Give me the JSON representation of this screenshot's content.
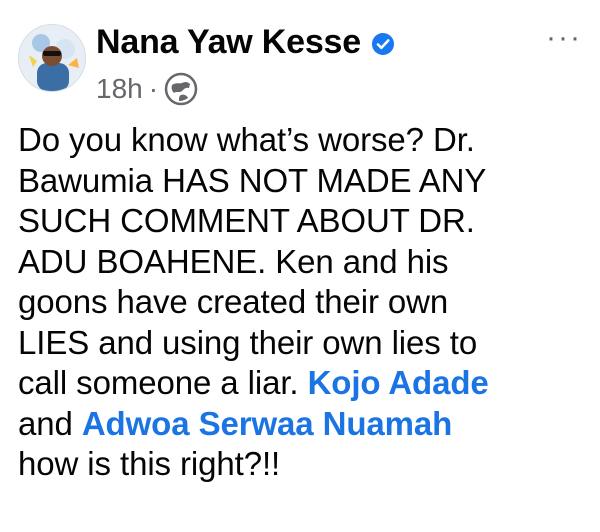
{
  "post": {
    "author": {
      "name": "Nana Yaw Kesse",
      "verified": true,
      "avatar_icon": "profile-photo"
    },
    "timestamp": "18h",
    "separator": "·",
    "audience_icon": "globe-icon",
    "more_icon": "ellipsis-icon",
    "more_label": "···",
    "body": {
      "line1": "Do you know what’s worse? Dr.",
      "line2": "Bawumia HAS NOT MADE ANY",
      "line3": "SUCH COMMENT ABOUT DR.",
      "line4": "ADU BOAHENE. Ken and his",
      "line5": "goons have created their own",
      "line6": "LIES and using their own lies to",
      "line7_text": "call someone a liar. ",
      "mention1": "Kojo Adade",
      "line8_text": "and ",
      "mention2": "Adwoa Serwaa Nuamah",
      "line9": "how is this right?!!"
    }
  },
  "colors": {
    "mention": "#1b74e4",
    "text": "#050505",
    "meta": "#65676b",
    "verified_badge": "#1877f2"
  }
}
